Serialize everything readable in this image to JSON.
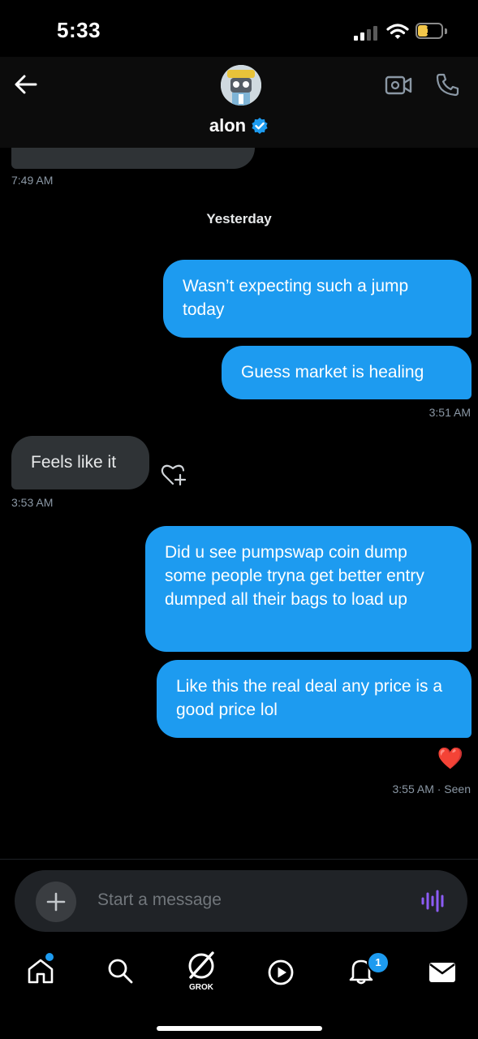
{
  "status_bar": {
    "time": "5:33",
    "battery_level": "1"
  },
  "header": {
    "contact_name": "alon",
    "verified": true
  },
  "messages": {
    "partial_time": "7:49 AM",
    "day_separator": "Yesterday",
    "out1": "Wasn’t expecting such a jump today",
    "out2": "Guess market is healing",
    "out2_time": "3:51 AM",
    "in1": "Feels like it",
    "in1_time": "3:53 AM",
    "out3": "Did u see pumpswap coin dump some people tryna get better entry dumped all their bags to load up",
    "out4": "Like this the real deal any price is a good price lol",
    "out4_reaction": "❤️",
    "out4_time": "3:55 AM",
    "out4_status": "· Seen"
  },
  "composer": {
    "placeholder": "Start a message"
  },
  "tabbar": {
    "grok_label": "GROK",
    "notifications_count": "1"
  },
  "colors": {
    "accent": "#1d9bf0",
    "incoming_bubble": "#2f3336",
    "background": "#000000"
  }
}
